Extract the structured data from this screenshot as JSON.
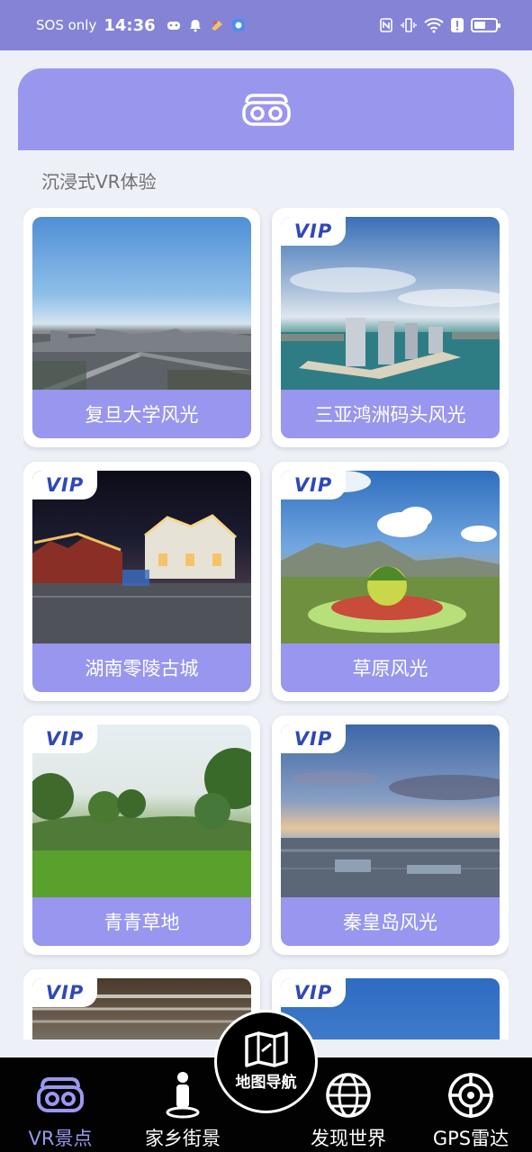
{
  "status_bar": {
    "carrier": "SOS only",
    "time": "14:36",
    "battery_level": 0.55
  },
  "header": {
    "icon": "vr-headset-icon"
  },
  "section_title": "沉浸式VR体验",
  "vip_text": "VIP",
  "cards": [
    {
      "label": "复旦大学风光",
      "vip": false
    },
    {
      "label": "三亚鸿洲码头风光",
      "vip": true
    },
    {
      "label": "湖南零陵古城",
      "vip": true
    },
    {
      "label": "草原风光",
      "vip": true
    },
    {
      "label": "青青草地",
      "vip": true
    },
    {
      "label": "秦皇岛风光",
      "vip": true
    },
    {
      "label": "",
      "vip": true
    },
    {
      "label": "",
      "vip": true
    }
  ],
  "bottom_nav": {
    "vr": "VR景点",
    "home": "家乡街景",
    "map": "地图导航",
    "discover": "发现世界",
    "gps": "GPS雷达",
    "active": "vr"
  },
  "colors": {
    "status_bar": "#8583d6",
    "accent": "#9896ee",
    "vip": "#2f48b8",
    "nav_active": "#9b97f0"
  }
}
